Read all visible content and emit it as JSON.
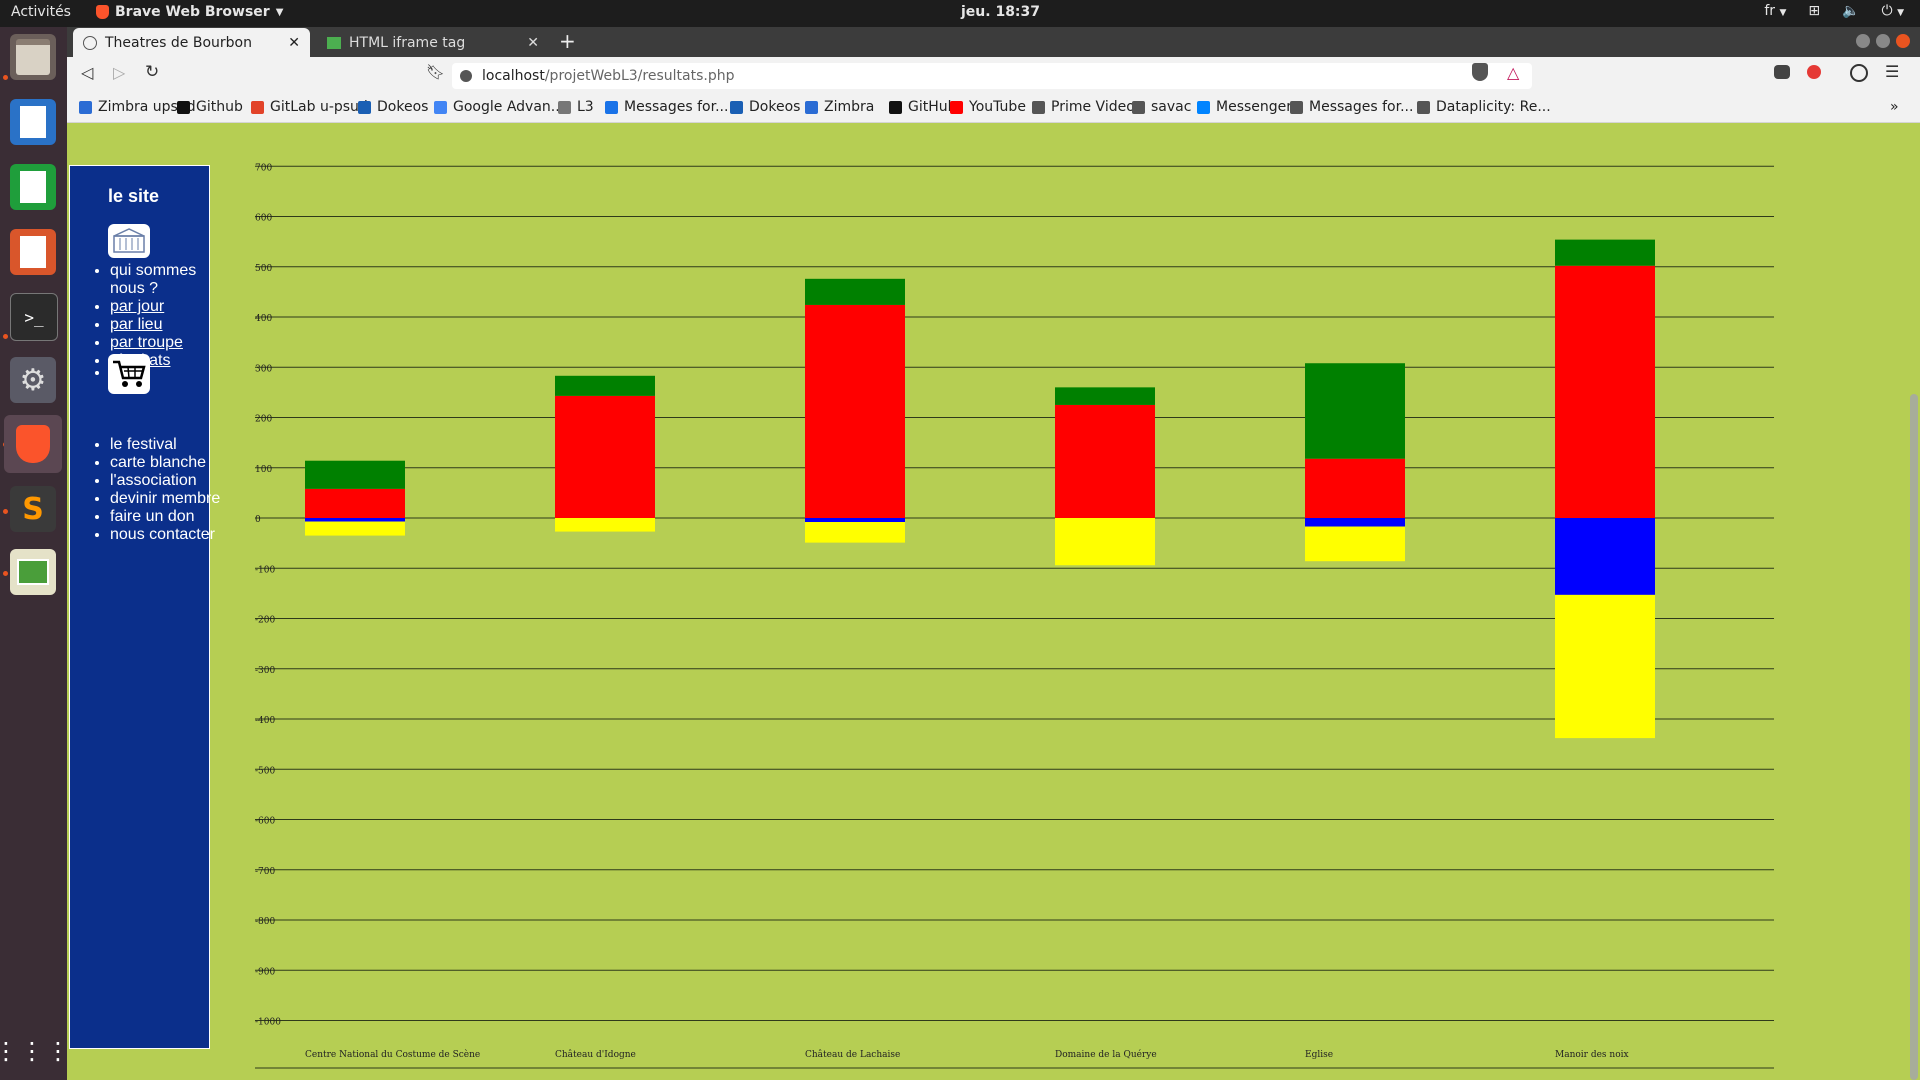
{
  "system": {
    "activities": "Activités",
    "app_name": "Brave Web Browser",
    "clock": "jeu. 18:37",
    "lang": "fr"
  },
  "browser": {
    "tabs": [
      {
        "label": "Theatres de Bourbon",
        "active": true
      },
      {
        "label": "HTML iframe tag",
        "active": false
      }
    ],
    "url_host": "localhost",
    "url_path": "/projetWebL3/resultats.php",
    "bookmarks": [
      {
        "label": "Zimbra upsud",
        "color": "#2b6cd4"
      },
      {
        "label": "Github",
        "color": "#111111"
      },
      {
        "label": "GitLab u-psud",
        "color": "#e24329"
      },
      {
        "label": "Dokeos",
        "color": "#1a5fb4"
      },
      {
        "label": "Google Advan...",
        "color": "#4285f4"
      },
      {
        "label": "L3",
        "color": "#777777"
      },
      {
        "label": "Messages for...",
        "color": "#1a73e8"
      },
      {
        "label": "Dokeos",
        "color": "#1a5fb4"
      },
      {
        "label": "Zimbra",
        "color": "#2b6cd4"
      },
      {
        "label": "GitHub",
        "color": "#111111"
      },
      {
        "label": "YouTube",
        "color": "#ff0000"
      },
      {
        "label": "Prime Video",
        "color": "#555555"
      },
      {
        "label": "savac",
        "color": "#555555"
      },
      {
        "label": "Messenger",
        "color": "#0084ff"
      },
      {
        "label": "Messages for...",
        "color": "#555555"
      },
      {
        "label": "Dataplicity: Re...",
        "color": "#555555"
      }
    ],
    "more_bookmarks": "»"
  },
  "sidenav": {
    "title": "le site",
    "items1": [
      {
        "label": "qui sommes nous ?",
        "link": false
      },
      {
        "label": "par jour",
        "link": true
      },
      {
        "label": "par lieu",
        "link": true
      },
      {
        "label": "par troupe",
        "link": true
      },
      {
        "label": "résultats",
        "link": true
      }
    ],
    "items2": [
      {
        "label": "le festival"
      },
      {
        "label": "carte blanche"
      },
      {
        "label": "l'association"
      },
      {
        "label": "devinir membre"
      },
      {
        "label": "faire un don"
      },
      {
        "label": "nous contacter"
      }
    ]
  },
  "chart_data": {
    "type": "bar",
    "stacked": true,
    "categories": [
      "Centre National du Costume de Scène",
      "Château d'Idogne",
      "Château de Lachaise",
      "Domaine de la Quérye",
      "Eglise",
      "Manoir des noix"
    ],
    "ylim": [
      -1000,
      800
    ],
    "yticks": [
      700,
      600,
      500,
      400,
      300,
      200,
      100,
      0,
      -100,
      -200,
      -300,
      -400,
      -500,
      -600,
      -700,
      -800,
      -900,
      -1000
    ],
    "grid": true,
    "series": [
      {
        "color": "#ff0000",
        "values": [
          58,
          243,
          424,
          225,
          118,
          502
        ],
        "side": "positive"
      },
      {
        "color": "#008000",
        "values": [
          56,
          40,
          52,
          35,
          190,
          52
        ],
        "side": "positive"
      },
      {
        "color": "#0000ff",
        "values": [
          -7,
          0,
          -8,
          0,
          -17,
          -153
        ],
        "side": "negative"
      },
      {
        "color": "#ffff00",
        "values": [
          -28,
          -27,
          -41,
          -94,
          -69,
          -285
        ],
        "side": "negative"
      }
    ]
  }
}
